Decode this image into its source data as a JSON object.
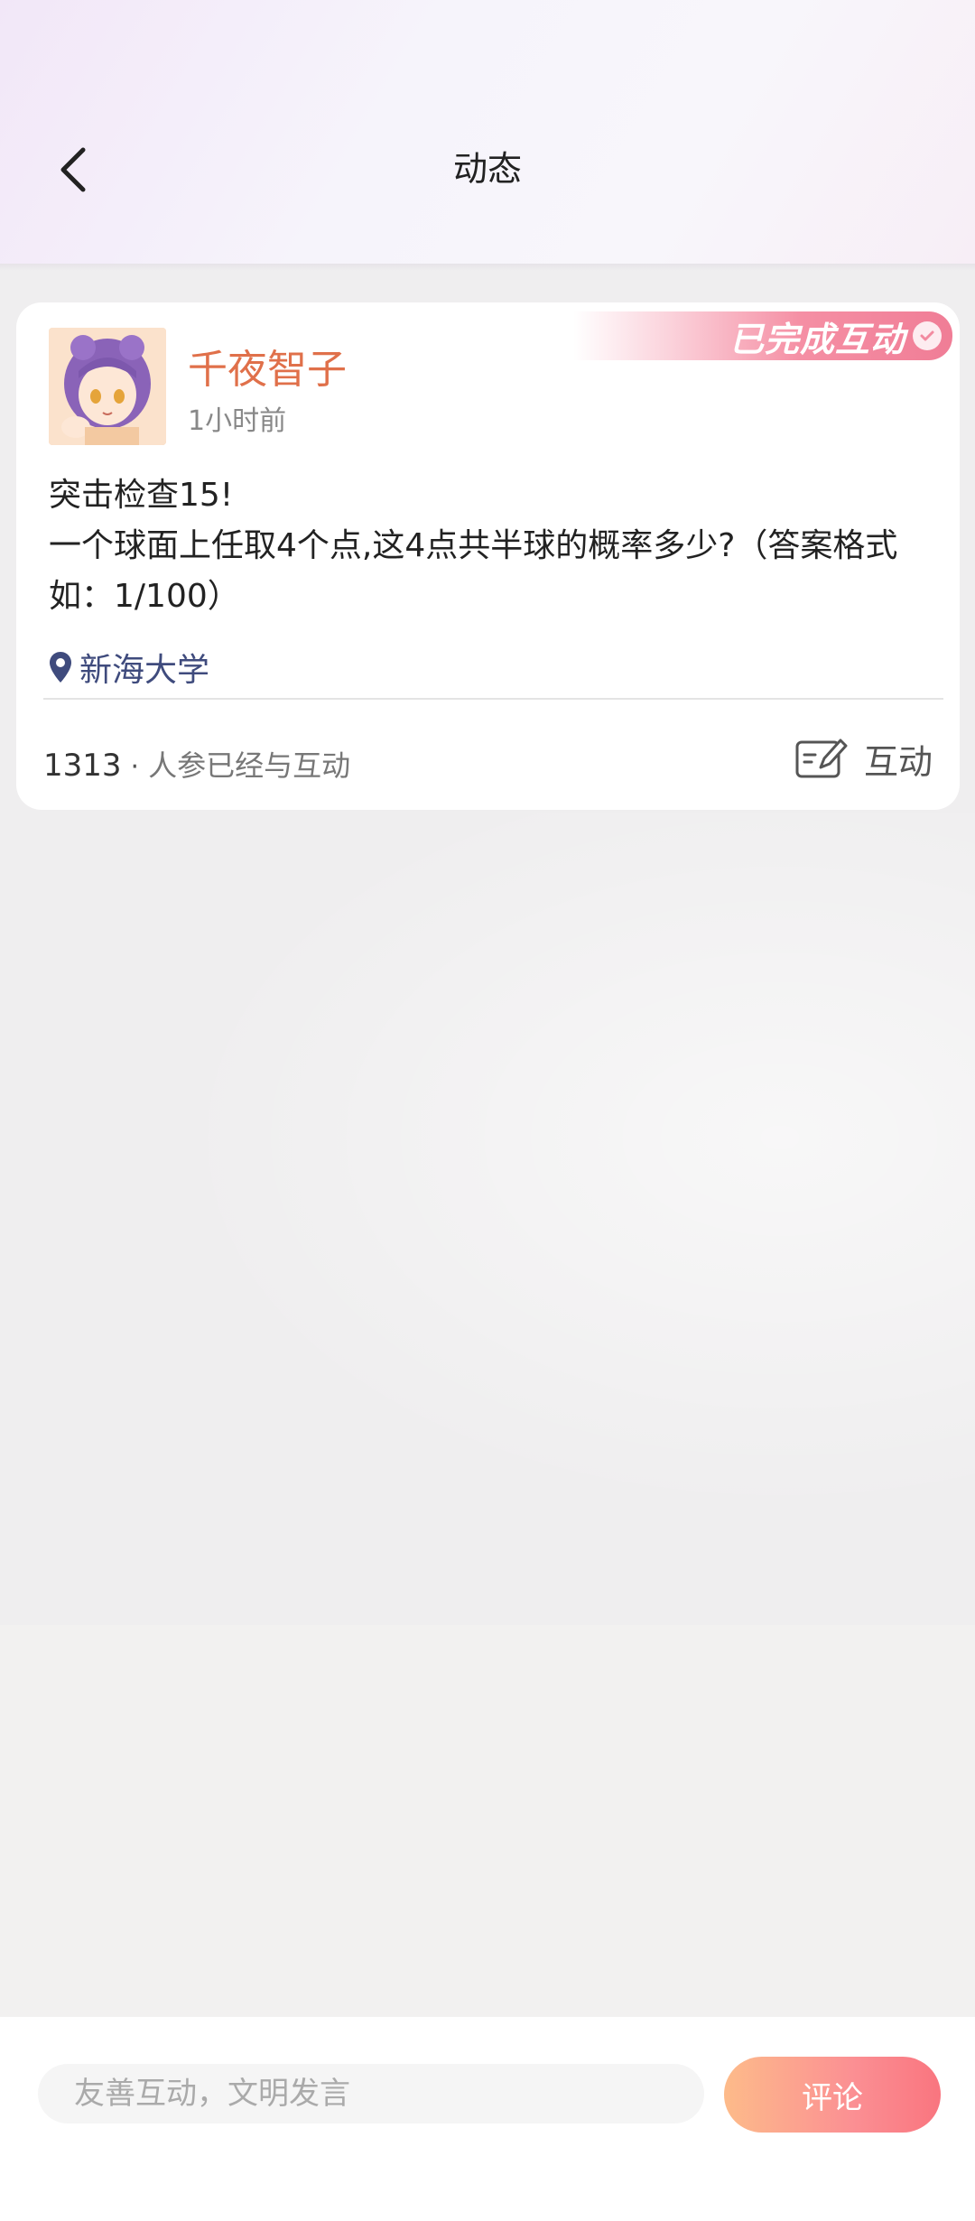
{
  "header": {
    "title": "动态",
    "back_icon": "chevron-left-icon"
  },
  "post": {
    "badge_text": "已完成互动",
    "badge_icon": "check-circle-icon",
    "username": "千夜智子",
    "timestamp": "1小时前",
    "content": "突击检查15!\n一个球面上任取4个点,这4点共半球的概率多少?（答案格式如：1/100）",
    "location": "新海大学",
    "location_icon": "location-pin-icon",
    "participant_count": "1313",
    "participant_separator": "·",
    "participant_label": "人参已经与互动",
    "interact_label": "互动",
    "interact_icon": "edit-note-icon"
  },
  "comment_bar": {
    "placeholder": "友善互动，文明发言",
    "submit_label": "评论"
  },
  "colors": {
    "username": "#e0704a",
    "location": "#3f4b7d",
    "accent_start": "#fdbb8a",
    "accent_end": "#f9757f"
  }
}
